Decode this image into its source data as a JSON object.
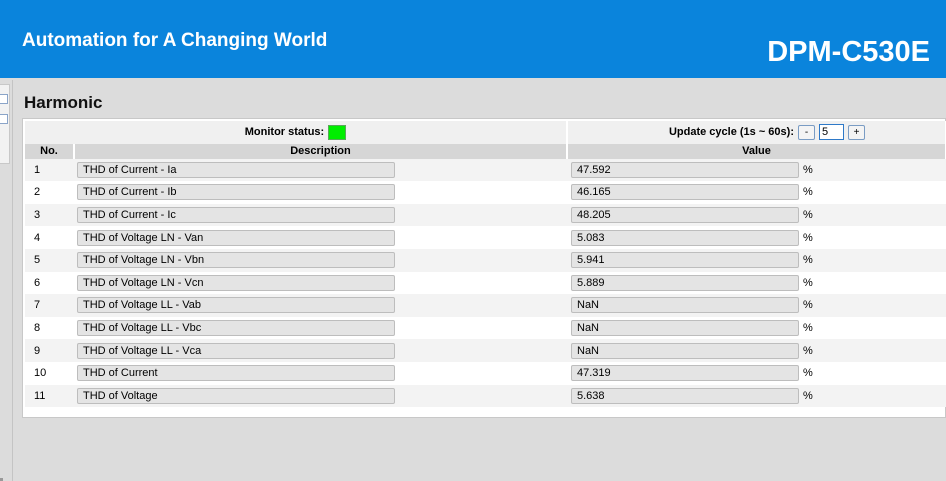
{
  "header": {
    "tagline": "Automation for A Changing World",
    "model": "DPM-C530E",
    "background_color": "#0a84dc"
  },
  "page": {
    "title": "Harmonic"
  },
  "status_bar": {
    "monitor_label": "Monitor status:",
    "monitor_color": "#00ee00",
    "update_label": "Update cycle (1s ~ 60s):",
    "decrement_label": "-",
    "increment_label": "+",
    "update_value": "5"
  },
  "table": {
    "columns": [
      "No.",
      "Description",
      "Value"
    ],
    "rows": [
      {
        "no": "1",
        "description": "THD of Current - Ia",
        "value": "47.592",
        "unit": "%"
      },
      {
        "no": "2",
        "description": "THD of Current - Ib",
        "value": "46.165",
        "unit": "%"
      },
      {
        "no": "3",
        "description": "THD of Current - Ic",
        "value": "48.205",
        "unit": "%"
      },
      {
        "no": "4",
        "description": "THD of Voltage LN - Van",
        "value": "5.083",
        "unit": "%"
      },
      {
        "no": "5",
        "description": "THD of Voltage LN - Vbn",
        "value": "5.941",
        "unit": "%"
      },
      {
        "no": "6",
        "description": "THD of Voltage LN - Vcn",
        "value": "5.889",
        "unit": "%"
      },
      {
        "no": "7",
        "description": "THD of Voltage LL - Vab",
        "value": "NaN",
        "unit": "%"
      },
      {
        "no": "8",
        "description": "THD of Voltage LL - Vbc",
        "value": "NaN",
        "unit": "%"
      },
      {
        "no": "9",
        "description": "THD of Voltage LL - Vca",
        "value": "NaN",
        "unit": "%"
      },
      {
        "no": "10",
        "description": "THD of Current",
        "value": "47.319",
        "unit": "%"
      },
      {
        "no": "11",
        "description": "THD of Voltage",
        "value": "5.638",
        "unit": "%"
      }
    ]
  }
}
